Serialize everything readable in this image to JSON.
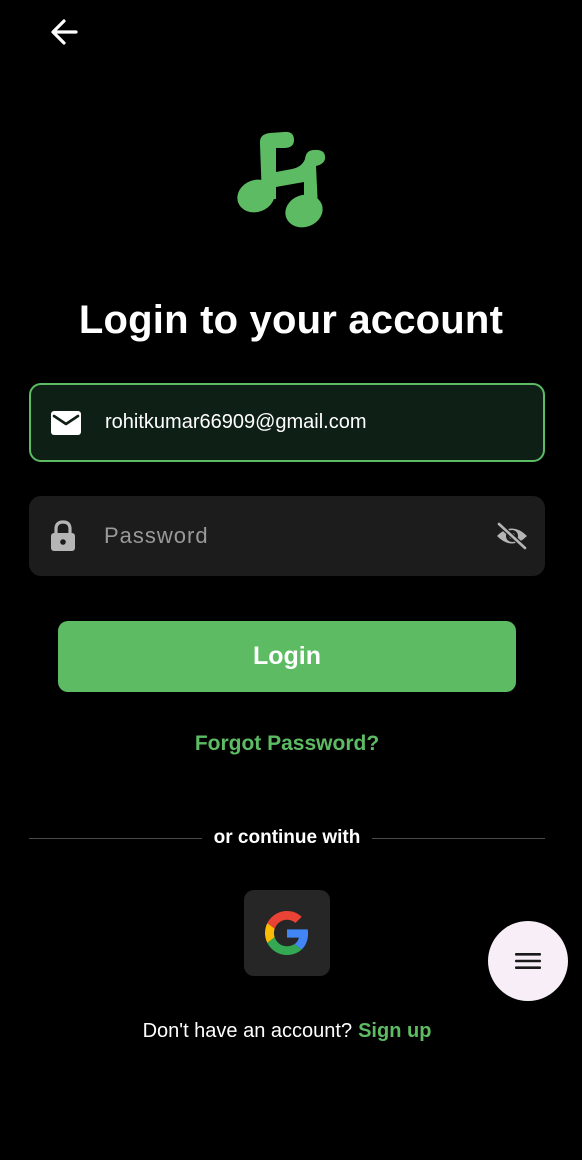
{
  "header": {
    "back_icon": "arrow-left-icon"
  },
  "logo": {
    "icon": "music-note-icon",
    "color": "#5cbb63"
  },
  "title": "Login to your account",
  "email": {
    "icon": "mail-icon",
    "value": "rohitkumar66909@gmail.com"
  },
  "password": {
    "icon": "lock-icon",
    "placeholder": "Password",
    "value": "",
    "visibility_icon": "eye-off-icon"
  },
  "login_button": "Login",
  "forgot_password": "Forgot Password?",
  "divider_text": "or continue with",
  "social": {
    "google_icon": "google-icon"
  },
  "fab_icon": "menu-icon",
  "signup": {
    "prompt": "Don't have an account?",
    "link": "Sign up"
  },
  "colors": {
    "accent": "#5cbb63",
    "background": "#000000",
    "field_active_bg": "#0e1f16",
    "field_bg": "#1c1c1c"
  }
}
